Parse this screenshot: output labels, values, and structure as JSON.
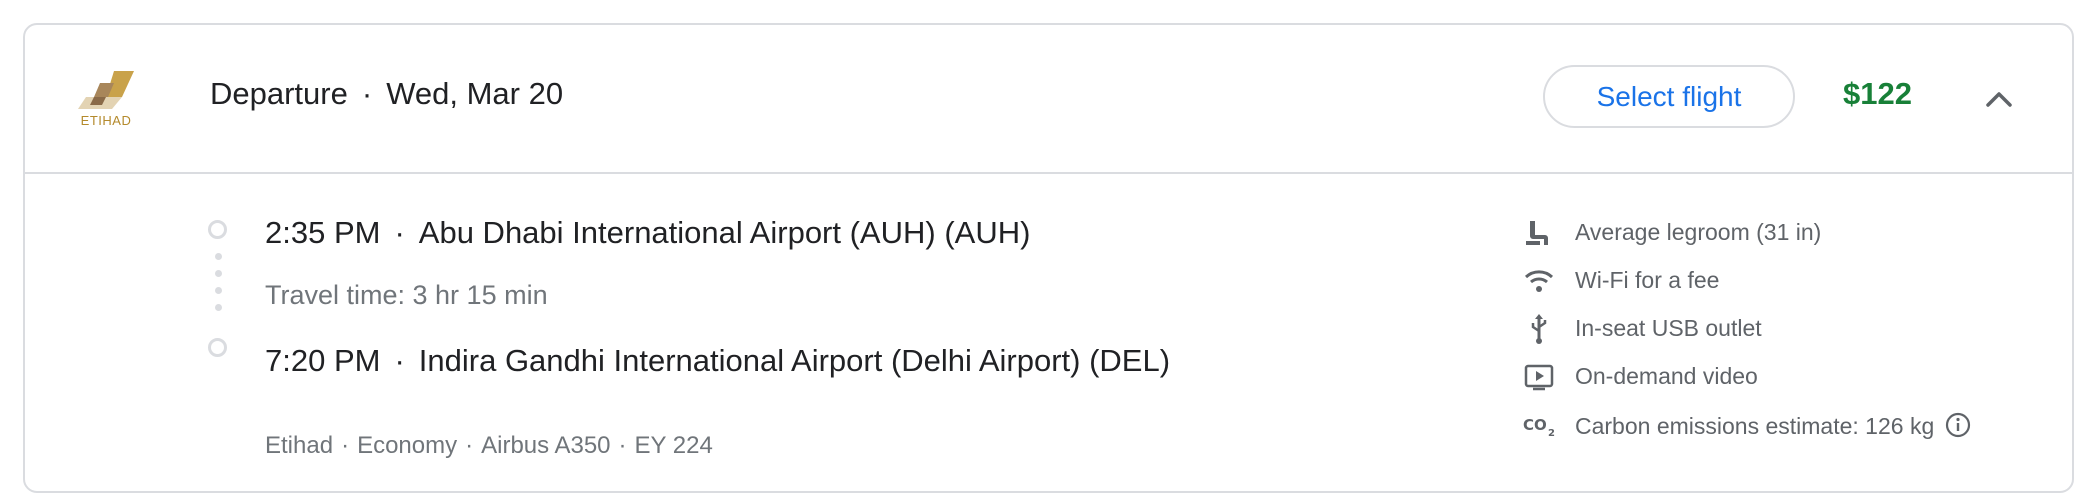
{
  "header": {
    "airline_logo_text": "ETIHAD",
    "title": "Departure",
    "date": "Wed, Mar 20",
    "select_label": "Select flight",
    "price": "$122",
    "price_color": "#188038",
    "accent_color": "#1a73e8",
    "collapse_icon": "chevron-up-icon"
  },
  "itinerary": {
    "departure": {
      "time": "2:35 PM",
      "airport": "Abu Dhabi International Airport (AUH) (AUH)"
    },
    "travel_time": "Travel time: 3 hr 15 min",
    "arrival": {
      "time": "7:20 PM",
      "airport": "Indira Gandhi International Airport (Delhi Airport) (DEL)"
    },
    "details": [
      "Etihad",
      "Economy",
      "Airbus A350",
      "EY 224"
    ]
  },
  "amenities": [
    {
      "icon": "seat-icon",
      "label": "Average legroom (31 in)"
    },
    {
      "icon": "wifi-icon",
      "label": "Wi-Fi for a fee"
    },
    {
      "icon": "usb-icon",
      "label": "In-seat USB outlet"
    },
    {
      "icon": "video-icon",
      "label": "On-demand video"
    },
    {
      "icon": "co2-icon",
      "label": "Carbon emissions estimate: 126 kg"
    }
  ]
}
